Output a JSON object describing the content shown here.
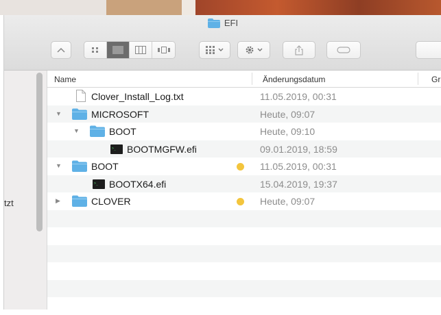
{
  "window": {
    "title": "EFI"
  },
  "toolbar": {
    "back_label": "^",
    "view_buttons": [
      "icon-view",
      "list-view",
      "column-view",
      "gallery-view"
    ],
    "arrange_icon": "grid-icon",
    "action_icon": "gear-icon",
    "share_icon": "share-icon",
    "tags_icon": "tag-icon"
  },
  "sidebar": {
    "partial_label": "tzt"
  },
  "columns": {
    "name": "Name",
    "date": "Änderungsdatum",
    "size": "Gr"
  },
  "files": [
    {
      "name": "Clover_Install_Log.txt",
      "date": "11.05.2019, 00:31",
      "type": "text",
      "depth": 0,
      "disclosure": "none",
      "tag": false
    },
    {
      "name": "MICROSOFT",
      "date": "Heute, 09:07",
      "type": "folder",
      "depth": 0,
      "disclosure": "open",
      "tag": false
    },
    {
      "name": "BOOT",
      "date": "Heute, 09:10",
      "type": "folder",
      "depth": 1,
      "disclosure": "open",
      "tag": false
    },
    {
      "name": "BOOTMGFW.efi",
      "date": "09.01.2019, 18:59",
      "type": "exec",
      "depth": 2,
      "disclosure": "none",
      "tag": false
    },
    {
      "name": "BOOT",
      "date": "11.05.2019, 00:31",
      "type": "folder",
      "depth": 0,
      "disclosure": "open",
      "tag": true
    },
    {
      "name": "BOOTX64.efi",
      "date": "15.04.2019, 19:37",
      "type": "exec",
      "depth": 1,
      "disclosure": "none",
      "tag": false
    },
    {
      "name": "CLOVER",
      "date": "Heute, 09:07",
      "type": "folder",
      "depth": 0,
      "disclosure": "closed",
      "tag": true
    }
  ],
  "colors": {
    "folder": "#5fb1e6",
    "tag_yellow": "#f3c53d",
    "selected_view": "#6c6c6c"
  }
}
